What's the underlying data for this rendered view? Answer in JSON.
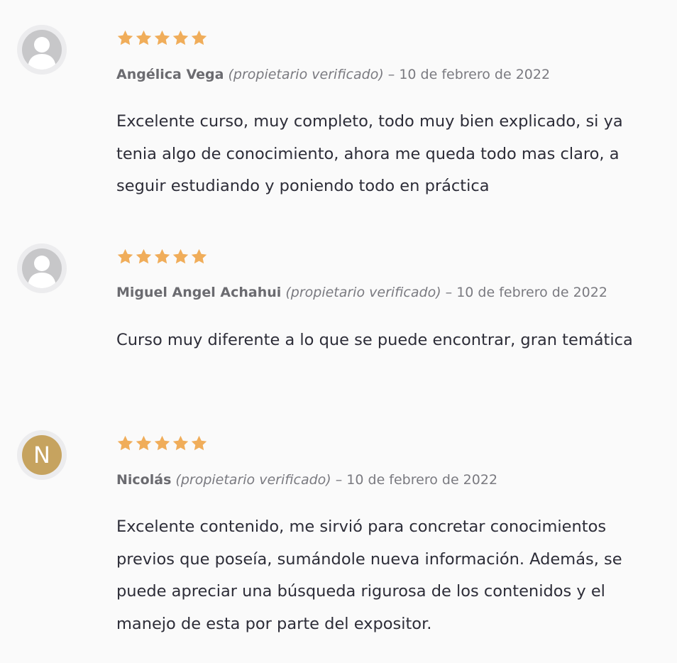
{
  "reviews": [
    {
      "avatar": "default-user-icon",
      "avatar_letter": "",
      "rating": 5,
      "author": "Angélica Vega",
      "verified": "(propietario verificado)",
      "separator": "–",
      "date": "10 de febrero de 2022",
      "text": "Excelente curso, muy completo, todo muy bien explicado, si ya tenia algo de conocimiento, ahora me queda todo mas claro, a seguir estudiando y poniendo todo en práctica"
    },
    {
      "avatar": "default-user-icon",
      "avatar_letter": "",
      "rating": 5,
      "author": "Miguel Angel Achahui",
      "verified": "(propietario verificado)",
      "separator": "–",
      "date": "10 de febrero de 2022",
      "text": "Curso muy diferente a lo que se puede encontrar, gran temática"
    },
    {
      "avatar": "letter-avatar",
      "avatar_letter": "N",
      "rating": 5,
      "author": "Nicolás",
      "verified": "(propietario verificado)",
      "separator": "–",
      "date": "10 de febrero de 2022",
      "text": "Excelente contenido, me sirvió para concretar conocimientos previos que poseía, sumándole nueva información. Además, se puede apreciar una búsqueda rigurosa de los contenidos y el manejo de esta por parte del expositor."
    }
  ],
  "colors": {
    "star": "#f0ad5a",
    "letter_avatar_bg": "#c6a35f",
    "default_avatar_bg": "#c7c7c9",
    "page_bg": "#fafafa"
  },
  "icons": {
    "star": "star-icon",
    "user": "user-silhouette-icon"
  }
}
